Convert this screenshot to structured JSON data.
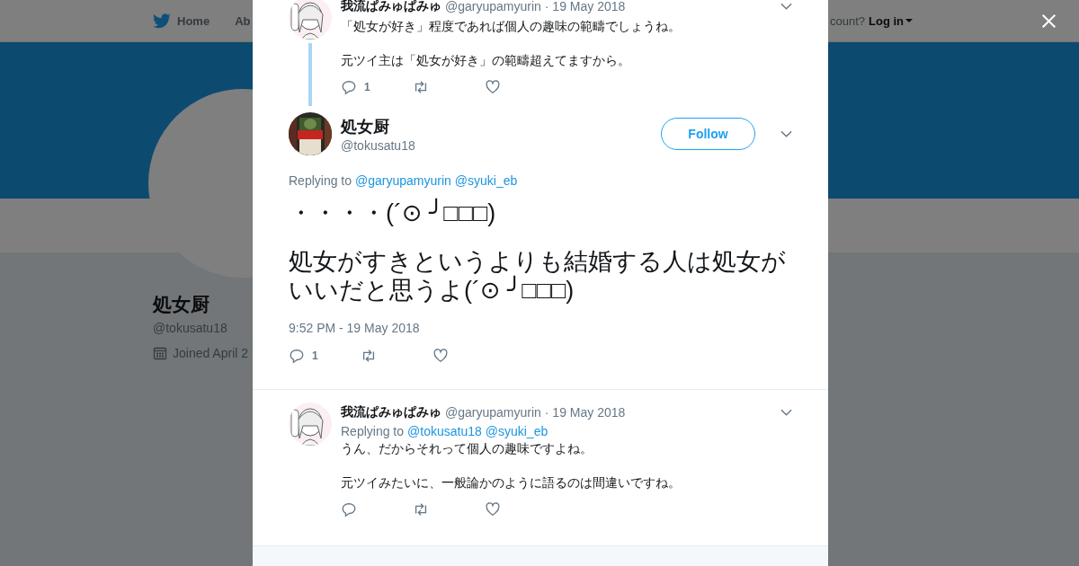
{
  "nav": {
    "items": [
      {
        "label": "Home",
        "kind": "home"
      },
      {
        "label": "Ab",
        "kind": "plain"
      }
    ],
    "account_prompt": "count?",
    "login": "Log in"
  },
  "profile": {
    "name": "処女厨",
    "handle": "@tokusatu18",
    "joined": "Joined April 2"
  },
  "modal": {
    "tweets": [
      {
        "kind": "reply",
        "thread": true,
        "name": "我流ぱみゅぱみゅ",
        "handle": "@garyupamyurin",
        "date": "· 19 May 2018",
        "paragraphs": [
          "「処女が好き」程度であれば個人の趣味の範疇でしょうね。",
          "元ツイ主は「処女が好き」の範疇超えてますから。"
        ],
        "replies": "1"
      },
      {
        "kind": "main",
        "name": "処女厨",
        "handle": "@tokusatu18",
        "follow": "Follow",
        "replying_label": "Replying to",
        "replying_to": [
          "@garyupamyurin",
          "@syuki_eb"
        ],
        "paragraphs": [
          "・・・・(´⊙ ╯□□□)",
          "処女がすきというよりも結婚する人は処女がいいだと思うよ(´⊙ ╯□□□)"
        ],
        "timestamp": "9:52 PM - 19 May 2018",
        "replies": "1"
      },
      {
        "kind": "reply",
        "name": "我流ぱみゅぱみゅ",
        "handle": "@garyupamyurin",
        "date": "· 19 May 2018",
        "replying_label": "Replying to",
        "replying_to": [
          "@tokusatu18",
          "@syuki_eb"
        ],
        "paragraphs": [
          "うん、だからそれって個人の趣味ですよね。",
          "元ツイみたいに、一般論かのように語るのは間違いですね。"
        ]
      }
    ]
  }
}
